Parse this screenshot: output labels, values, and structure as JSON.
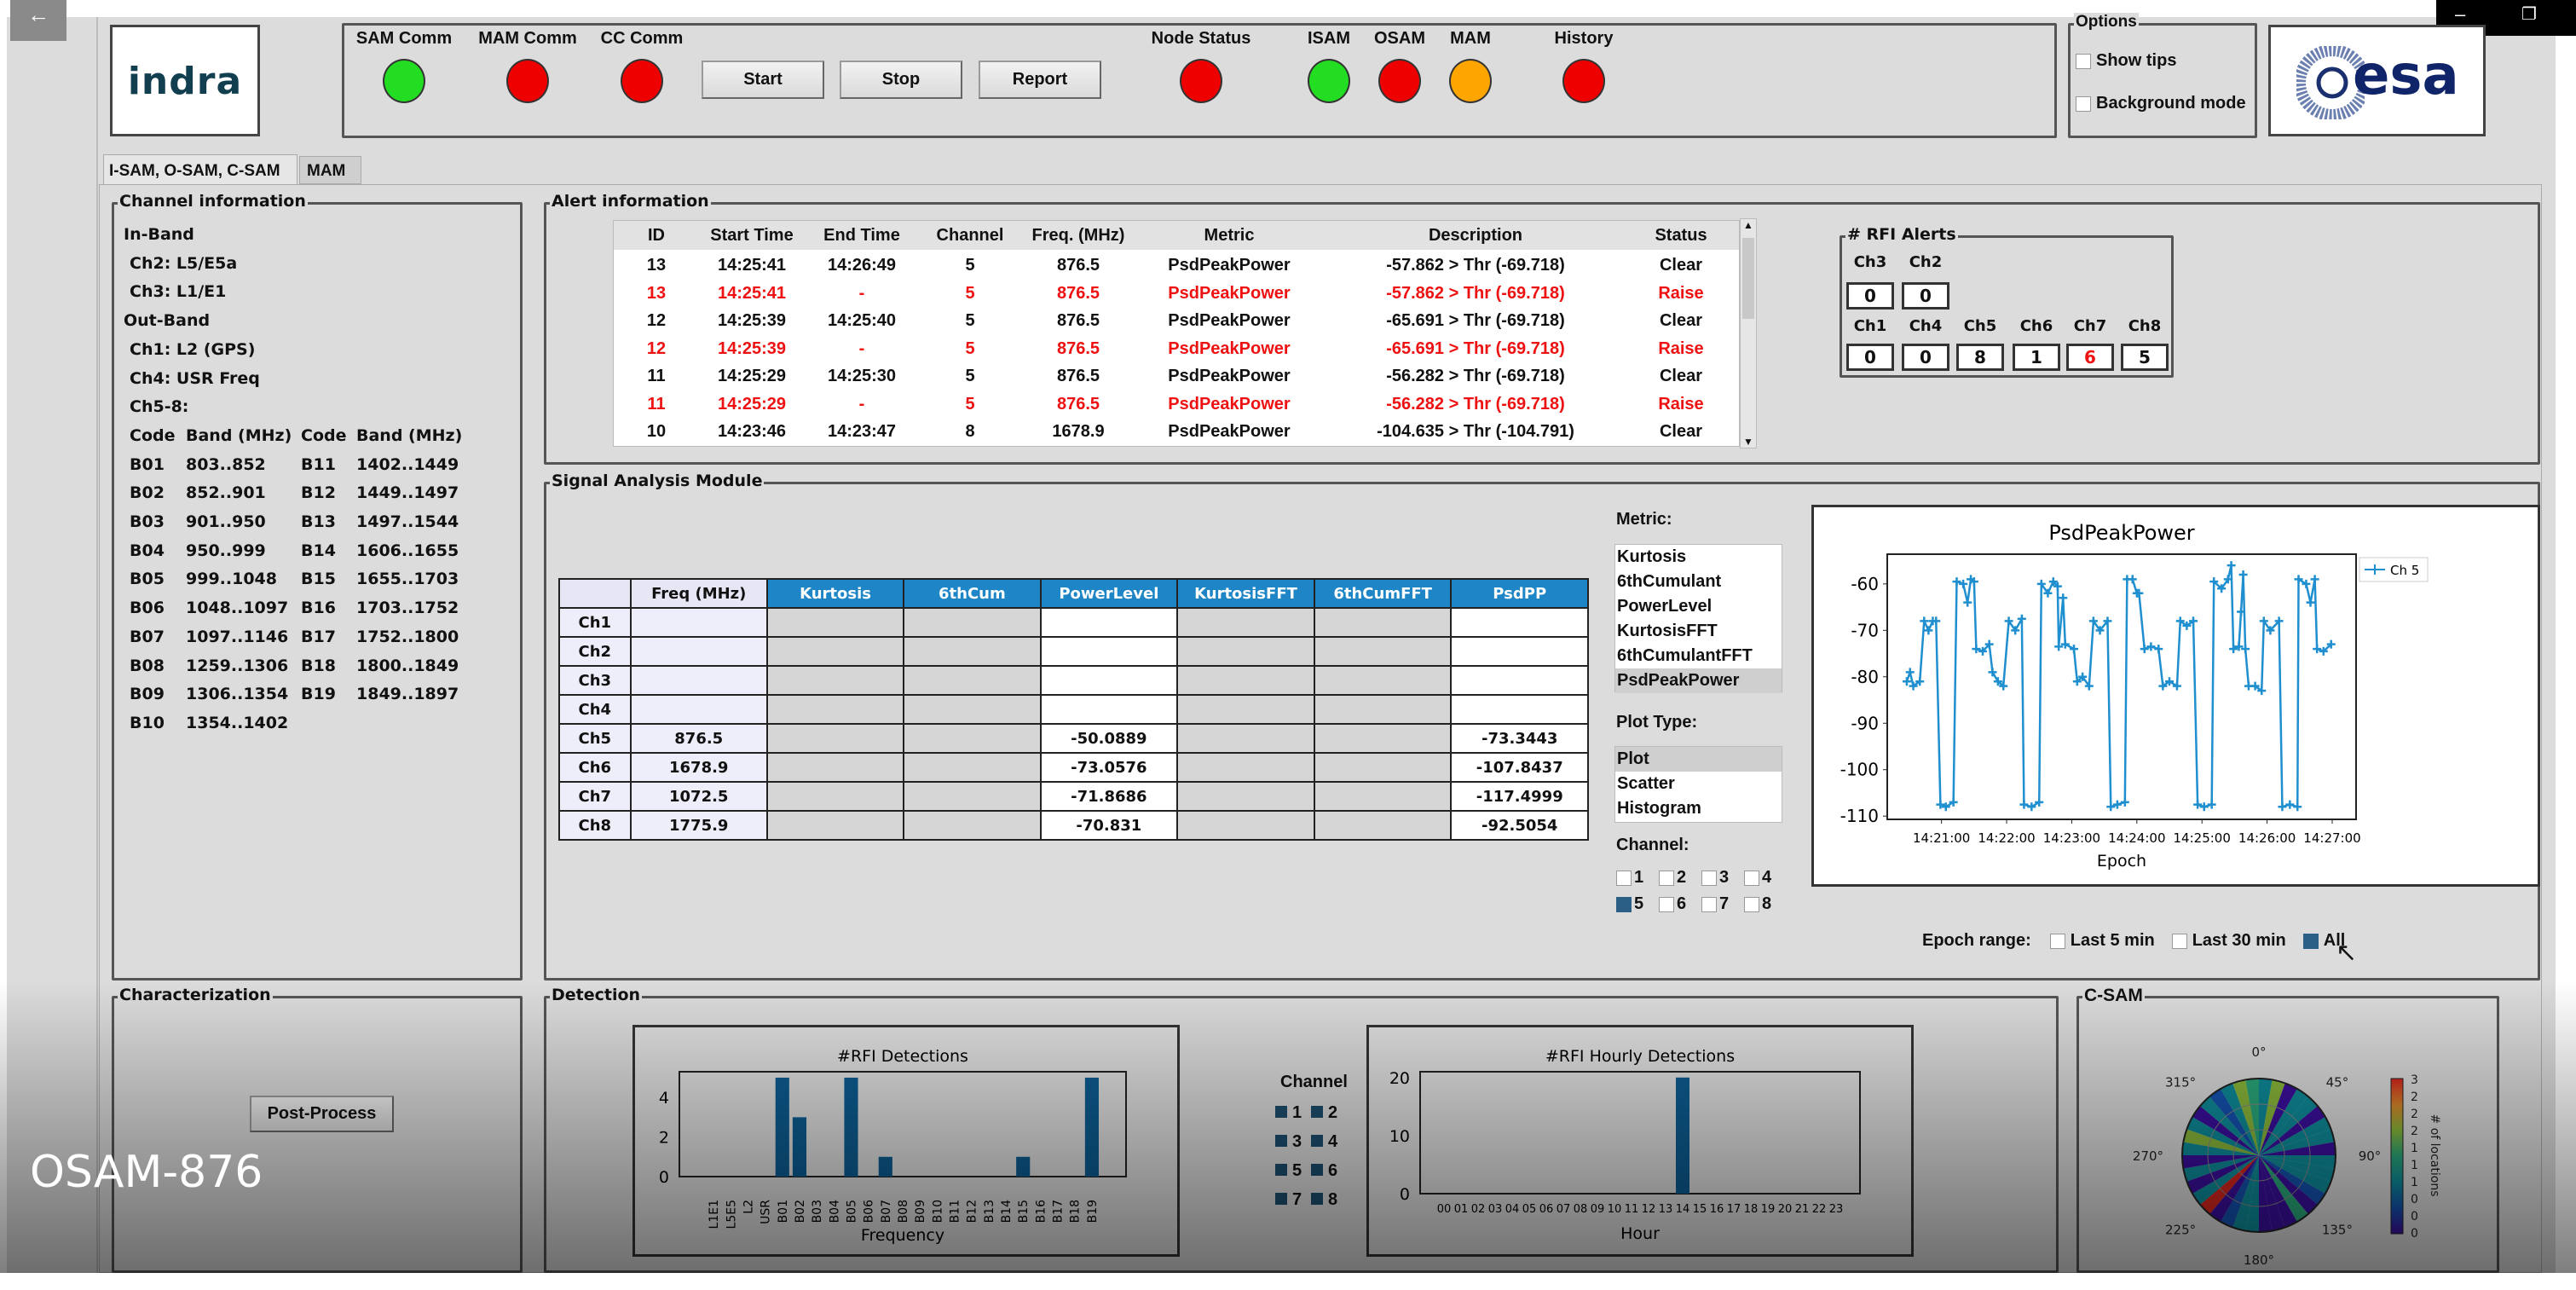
{
  "header": {
    "status_labels": [
      "SAM Comm",
      "MAM Comm",
      "CC Comm",
      "Node Status",
      "ISAM",
      "OSAM",
      "MAM",
      "History"
    ],
    "status_colors": [
      "#22dd22",
      "#ee0000",
      "#ee0000",
      "#ee0000",
      "#22dd22",
      "#ee0000",
      "#ffa500",
      "#ee0000"
    ],
    "buttons": {
      "start": "Start",
      "stop": "Stop",
      "report": "Report"
    },
    "logo_left": "indra",
    "logo_right": "esa",
    "options": {
      "title": "Options",
      "show_tips": "Show tips",
      "background_mode": "Background mode"
    }
  },
  "tabs": [
    "I-SAM, O-SAM, C-SAM",
    "MAM"
  ],
  "channel_info": {
    "title": "Channel information",
    "in_band": "In-Band",
    "in_band_items": [
      "Ch2: L5/E5a",
      "Ch3: L1/E1"
    ],
    "out_band": "Out-Band",
    "out_band_items": [
      "Ch1: L2 (GPS)",
      "Ch4: USR Freq",
      "Ch5-8:"
    ],
    "headers": [
      "Code",
      "Band (MHz)",
      "Code",
      "Band (MHz)"
    ],
    "bands_left": [
      [
        "B01",
        "803..852"
      ],
      [
        "B02",
        "852..901"
      ],
      [
        "B03",
        "901..950"
      ],
      [
        "B04",
        "950..999"
      ],
      [
        "B05",
        "999..1048"
      ],
      [
        "B06",
        "1048..1097"
      ],
      [
        "B07",
        "1097..1146"
      ],
      [
        "B08",
        "1259..1306"
      ],
      [
        "B09",
        "1306..1354"
      ],
      [
        "B10",
        "1354..1402"
      ]
    ],
    "bands_right": [
      [
        "B11",
        "1402..1449"
      ],
      [
        "B12",
        "1449..1497"
      ],
      [
        "B13",
        "1497..1544"
      ],
      [
        "B14",
        "1606..1655"
      ],
      [
        "B15",
        "1655..1703"
      ],
      [
        "B16",
        "1703..1752"
      ],
      [
        "B17",
        "1752..1800"
      ],
      [
        "B18",
        "1800..1849"
      ],
      [
        "B19",
        "1849..1897"
      ]
    ]
  },
  "alerts": {
    "title": "Alert information",
    "columns": [
      "ID",
      "Start Time",
      "End Time",
      "Channel",
      "Freq. (MHz)",
      "Metric",
      "Description",
      "Status"
    ],
    "rows": [
      {
        "cells": [
          "13",
          "14:25:41",
          "14:26:49",
          "5",
          "876.5",
          "PsdPeakPower",
          "-57.862 > Thr (-69.718)",
          "Clear"
        ],
        "raise": false
      },
      {
        "cells": [
          "13",
          "14:25:41",
          "-",
          "5",
          "876.5",
          "PsdPeakPower",
          "-57.862 > Thr (-69.718)",
          "Raise"
        ],
        "raise": true
      },
      {
        "cells": [
          "12",
          "14:25:39",
          "14:25:40",
          "5",
          "876.5",
          "PsdPeakPower",
          "-65.691 > Thr (-69.718)",
          "Clear"
        ],
        "raise": false
      },
      {
        "cells": [
          "12",
          "14:25:39",
          "-",
          "5",
          "876.5",
          "PsdPeakPower",
          "-65.691 > Thr (-69.718)",
          "Raise"
        ],
        "raise": true
      },
      {
        "cells": [
          "11",
          "14:25:29",
          "14:25:30",
          "5",
          "876.5",
          "PsdPeakPower",
          "-56.282 > Thr (-69.718)",
          "Clear"
        ],
        "raise": false
      },
      {
        "cells": [
          "11",
          "14:25:29",
          "-",
          "5",
          "876.5",
          "PsdPeakPower",
          "-56.282 > Thr (-69.718)",
          "Raise"
        ],
        "raise": true
      },
      {
        "cells": [
          "10",
          "14:23:46",
          "14:23:47",
          "8",
          "1678.9",
          "PsdPeakPower",
          "-104.635 > Thr (-104.791)",
          "Clear"
        ],
        "raise": false
      }
    ],
    "raise_color": "#ee1111"
  },
  "rfi_alerts": {
    "title": "# RFI Alerts",
    "row1": [
      {
        "label": "Ch3",
        "value": "0"
      },
      {
        "label": "Ch2",
        "value": "0"
      }
    ],
    "row2": [
      {
        "label": "Ch1",
        "value": "0"
      },
      {
        "label": "Ch4",
        "value": "0"
      },
      {
        "label": "Ch5",
        "value": "8"
      },
      {
        "label": "Ch6",
        "value": "1"
      },
      {
        "label": "Ch7",
        "value": "6",
        "alert": true
      },
      {
        "label": "Ch8",
        "value": "5"
      }
    ]
  },
  "signal": {
    "title": "Signal Analysis Module",
    "columns": [
      "Freq (MHz)",
      "Kurtosis",
      "6thCum",
      "PowerLevel",
      "KurtosisFFT",
      "6thCumFFT",
      "PsdPP"
    ],
    "rows": [
      [
        "Ch1",
        "",
        "",
        "",
        "",
        "",
        "",
        ""
      ],
      [
        "Ch2",
        "",
        "",
        "",
        "",
        "",
        "",
        ""
      ],
      [
        "Ch3",
        "",
        "",
        "",
        "",
        "",
        "",
        ""
      ],
      [
        "Ch4",
        "",
        "",
        "",
        "",
        "",
        "",
        ""
      ],
      [
        "Ch5",
        "876.5",
        "",
        "",
        "-50.0889",
        "",
        "",
        "-73.3443"
      ],
      [
        "Ch6",
        "1678.9",
        "",
        "",
        "-73.0576",
        "",
        "",
        "-107.8437"
      ],
      [
        "Ch7",
        "1072.5",
        "",
        "",
        "-71.8686",
        "",
        "",
        "-117.4999"
      ],
      [
        "Ch8",
        "1775.9",
        "",
        "",
        "-70.831",
        "",
        "",
        "-92.5054"
      ]
    ],
    "metric_label": "Metric:",
    "metrics": [
      "Kurtosis",
      "6thCumulant",
      "PowerLevel",
      "KurtosisFFT",
      "6thCumulantFFT",
      "PsdPeakPower"
    ],
    "metric_selected": "PsdPeakPower",
    "plot_type_label": "Plot Type:",
    "plot_types": [
      "Plot",
      "Scatter",
      "Histogram"
    ],
    "plot_type_selected": "Plot",
    "channel_label": "Channel:",
    "channels": [
      "1",
      "2",
      "3",
      "4",
      "5",
      "6",
      "7",
      "8"
    ],
    "channels_checked": [
      "5"
    ],
    "epoch_label": "Epoch range:",
    "epoch_options": [
      "Last 5 min",
      "Last 30 min",
      "All"
    ],
    "epoch_selected": "All",
    "header_color": "#1e86c6"
  },
  "characterization": {
    "title": "Characterization",
    "post_process": "Post-Process"
  },
  "detection": {
    "title": "Detection",
    "channel_legend_title": "Channel",
    "channel_legend": [
      "1",
      "2",
      "3",
      "4",
      "5",
      "6",
      "7",
      "8"
    ]
  },
  "csam": {
    "title": "C-SAM"
  },
  "video_caption": "OSAM-876",
  "chart_data": [
    {
      "type": "line",
      "title": "PsdPeakPower",
      "xlabel": "Epoch",
      "ylabel": "",
      "legend": [
        "Ch 5"
      ],
      "legend_placement": "right",
      "x_ticks": [
        "14:21:00",
        "14:22:00",
        "14:23:00",
        "14:24:00",
        "14:25:00",
        "14:26:00",
        "14:27:00"
      ],
      "x_tick_seconds": [
        60,
        120,
        180,
        240,
        300,
        360,
        420
      ],
      "y_ticks": [
        -60,
        -70,
        -80,
        -90,
        -100,
        -110
      ],
      "xlim_seconds": [
        10,
        442
      ],
      "ylim": [
        -110.7,
        -53.6
      ],
      "color": "#1f8fcf",
      "points_seconds_after_14_20_00": [
        [
          28,
          -81
        ],
        [
          31,
          -79
        ],
        [
          34,
          -82
        ],
        [
          40,
          -81
        ],
        [
          44,
          -68
        ],
        [
          48,
          -70
        ],
        [
          52,
          -68
        ],
        [
          55,
          -68
        ],
        [
          59,
          -107.5
        ],
        [
          64,
          -108
        ],
        [
          71,
          -107
        ],
        [
          74,
          -59.5
        ],
        [
          80,
          -60
        ],
        [
          84,
          -64
        ],
        [
          87,
          -59
        ],
        [
          90,
          -59.5
        ],
        [
          92,
          -74
        ],
        [
          98,
          -74.5
        ],
        [
          104,
          -73
        ],
        [
          107,
          -79
        ],
        [
          112,
          -81
        ],
        [
          117,
          -82
        ],
        [
          122,
          -68
        ],
        [
          128,
          -70
        ],
        [
          134,
          -67.5
        ],
        [
          136,
          -107.5
        ],
        [
          143,
          -108
        ],
        [
          150,
          -107
        ],
        [
          152,
          -60
        ],
        [
          158,
          -62
        ],
        [
          163,
          -59.5
        ],
        [
          167,
          -60.5
        ],
        [
          168,
          -73.5
        ],
        [
          172,
          -63
        ],
        [
          174,
          -73
        ],
        [
          182,
          -74
        ],
        [
          185,
          -81
        ],
        [
          190,
          -80
        ],
        [
          196,
          -82
        ],
        [
          200,
          -68
        ],
        [
          206,
          -70
        ],
        [
          213,
          -68
        ],
        [
          216,
          -108
        ],
        [
          222,
          -107.5
        ],
        [
          229,
          -107
        ],
        [
          231,
          -59
        ],
        [
          236,
          -59
        ],
        [
          240,
          -62
        ],
        [
          242,
          -62
        ],
        [
          247,
          -74
        ],
        [
          253,
          -73.5
        ],
        [
          260,
          -74
        ],
        [
          264,
          -82
        ],
        [
          270,
          -81
        ],
        [
          277,
          -82
        ],
        [
          280,
          -68
        ],
        [
          286,
          -69
        ],
        [
          292,
          -68
        ],
        [
          296,
          -107.5
        ],
        [
          302,
          -108
        ],
        [
          309,
          -107.5
        ],
        [
          311,
          -59.5
        ],
        [
          318,
          -61
        ],
        [
          324,
          -59
        ],
        [
          327,
          -56
        ],
        [
          329,
          -74
        ],
        [
          334,
          -73.5
        ],
        [
          336,
          -66
        ],
        [
          338,
          -58
        ],
        [
          340,
          -74
        ],
        [
          343,
          -82
        ],
        [
          349,
          -82
        ],
        [
          355,
          -83
        ],
        [
          357,
          -68
        ],
        [
          363,
          -70
        ],
        [
          371,
          -68
        ],
        [
          374,
          -108
        ],
        [
          381,
          -107.5
        ],
        [
          388,
          -108
        ],
        [
          389,
          -59
        ],
        [
          396,
          -60
        ],
        [
          400,
          -64
        ],
        [
          404,
          -59
        ],
        [
          406,
          -74
        ],
        [
          412,
          -74.5
        ],
        [
          419,
          -73
        ]
      ]
    },
    {
      "type": "bar",
      "title": "#RFI Detections",
      "xlabel": "Frequency",
      "ylabel": "",
      "categories": [
        "L1E1",
        "L5E5",
        "L2",
        "USR",
        "B01",
        "B02",
        "B03",
        "B04",
        "B05",
        "B06",
        "B07",
        "B08",
        "B09",
        "B10",
        "B11",
        "B12",
        "B13",
        "B14",
        "B15",
        "B16",
        "B17",
        "B18",
        "B19"
      ],
      "values": [
        0,
        0,
        0,
        0,
        5,
        3,
        0,
        0,
        5,
        0,
        1,
        0,
        0,
        0,
        0,
        0,
        0,
        0,
        1,
        0,
        0,
        0,
        5
      ],
      "y_ticks": [
        0,
        2,
        4
      ],
      "ylim": [
        0,
        5.3
      ],
      "color": "#0d5d92"
    },
    {
      "type": "bar",
      "title": "#RFI Hourly Detections",
      "xlabel": "Hour",
      "ylabel": "",
      "categories": [
        "00",
        "01",
        "02",
        "03",
        "04",
        "05",
        "06",
        "07",
        "08",
        "09",
        "10",
        "11",
        "12",
        "13",
        "14",
        "15",
        "16",
        "17",
        "18",
        "19",
        "20",
        "21",
        "22",
        "23"
      ],
      "values": [
        0,
        0,
        0,
        0,
        0,
        0,
        0,
        0,
        0,
        0,
        0,
        0,
        0,
        0,
        20,
        0,
        0,
        0,
        0,
        0,
        0,
        0,
        0,
        0
      ],
      "y_ticks": [
        0,
        10,
        20
      ],
      "ylim": [
        0,
        21
      ],
      "color": "#0d5d92"
    },
    {
      "type": "heatmap",
      "subtype": "polar",
      "title": "",
      "angle_labels": [
        "0°",
        "45°",
        "90°",
        "135°",
        "180°",
        "225°",
        "270°",
        "315°"
      ],
      "sector_values": [
        1,
        2,
        0,
        1,
        1,
        0,
        1,
        1,
        0,
        1,
        1,
        1,
        0.5,
        0,
        1.5,
        0,
        0,
        0,
        1,
        1,
        0.5,
        0,
        3,
        1,
        0,
        1,
        0,
        1,
        2,
        1,
        0,
        1,
        0.5,
        1,
        2,
        1.5
      ],
      "colorbar_label": "# of locations",
      "colorbar_ticks": [
        "3",
        "2",
        "2",
        "2",
        "1",
        "1",
        "1",
        "0",
        "0",
        "0"
      ],
      "vlim": [
        0,
        3
      ]
    }
  ]
}
